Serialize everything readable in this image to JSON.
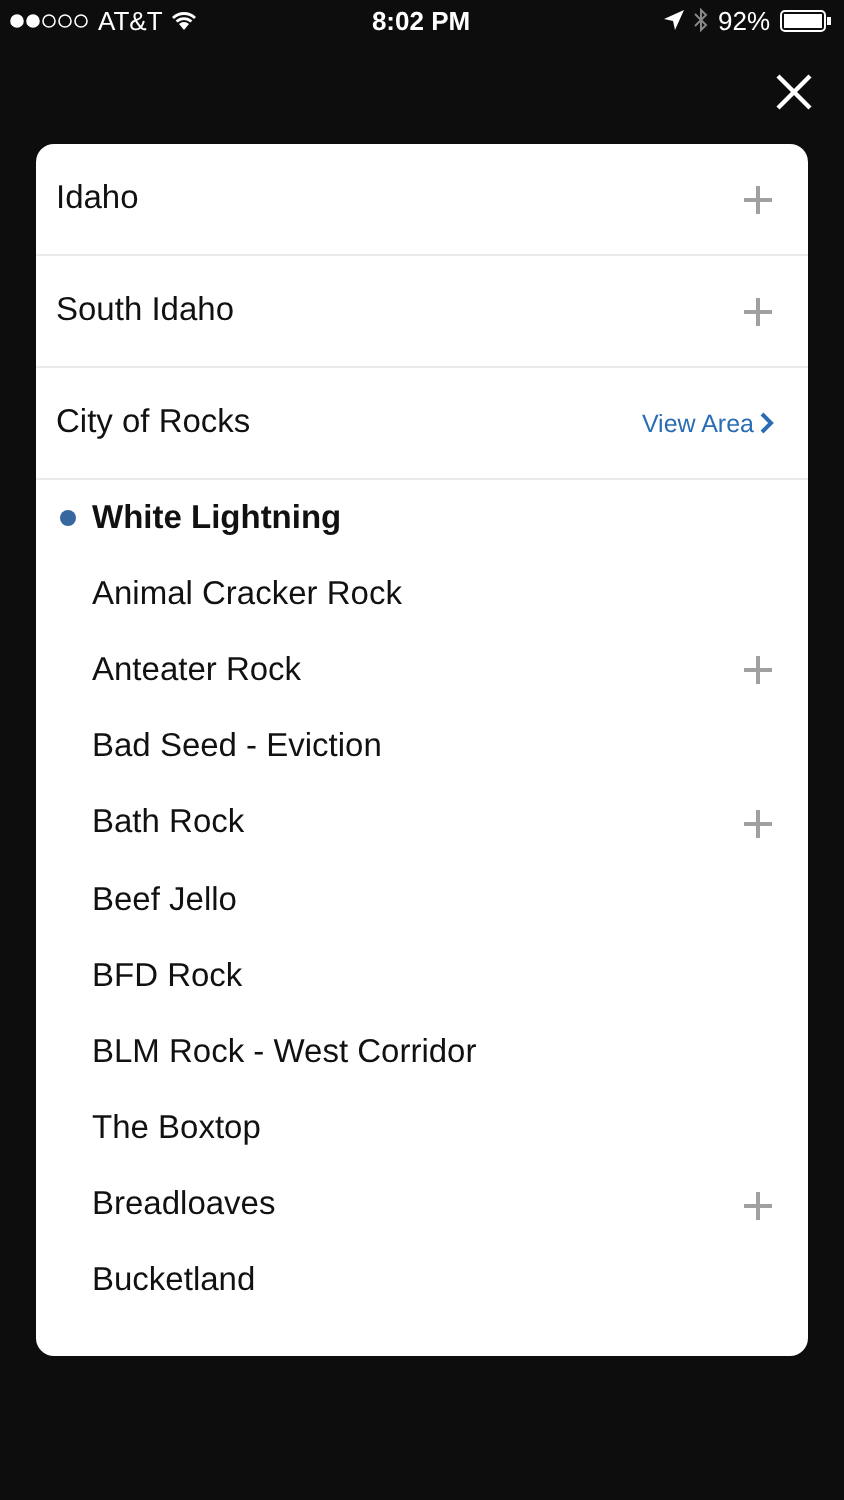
{
  "status_bar": {
    "carrier": "AT&T",
    "time": "8:02 PM",
    "battery": "92%"
  },
  "areas": [
    {
      "name": "Idaho",
      "kind": "expand"
    },
    {
      "name": "South Idaho",
      "kind": "expand"
    },
    {
      "name": "City of Rocks",
      "kind": "link",
      "link": "View Area"
    }
  ],
  "routes": [
    {
      "name": "White Lightning",
      "selected": true,
      "expandable": false
    },
    {
      "name": "Animal Cracker Rock",
      "selected": false,
      "expandable": false
    },
    {
      "name": "Anteater Rock",
      "selected": false,
      "expandable": true
    },
    {
      "name": "Bad Seed - Eviction",
      "selected": false,
      "expandable": false
    },
    {
      "name": "Bath Rock",
      "selected": false,
      "expandable": true
    },
    {
      "name": "Beef Jello",
      "selected": false,
      "expandable": false
    },
    {
      "name": "BFD Rock",
      "selected": false,
      "expandable": false
    },
    {
      "name": "BLM Rock - West Corridor",
      "selected": false,
      "expandable": false
    },
    {
      "name": "The Boxtop",
      "selected": false,
      "expandable": false
    },
    {
      "name": "Breadloaves",
      "selected": false,
      "expandable": true
    },
    {
      "name": "Bucketland",
      "selected": false,
      "expandable": false
    }
  ]
}
